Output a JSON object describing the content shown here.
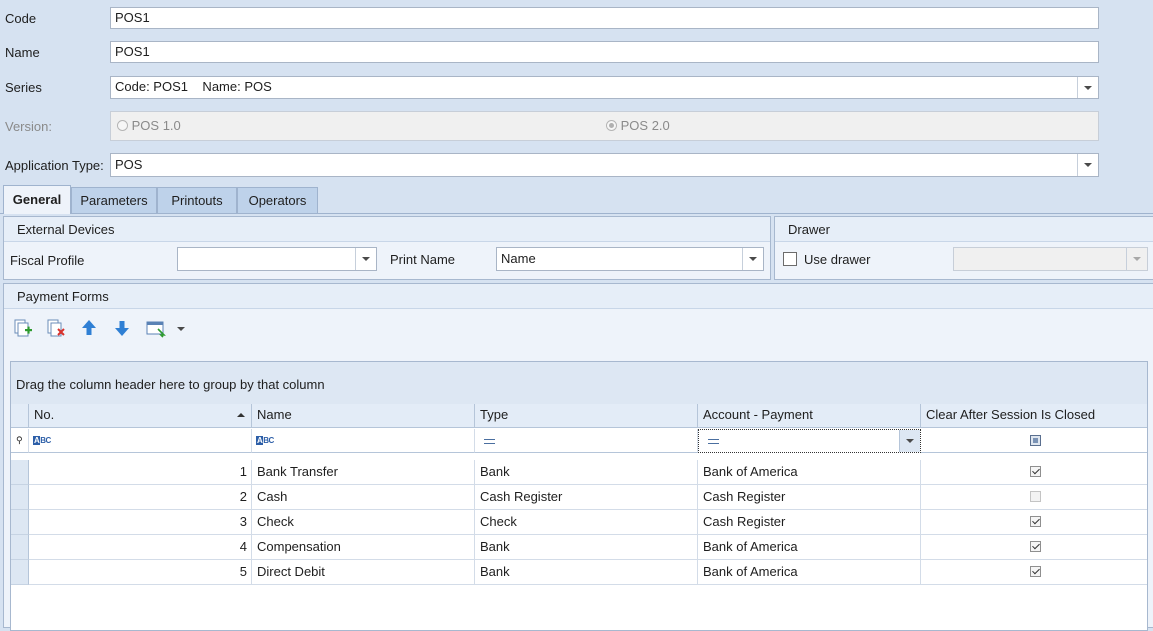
{
  "form": {
    "code_label": "Code",
    "code_value": "POS1",
    "name_label": "Name",
    "name_value": "POS1",
    "series_label": "Series",
    "series_value": "Code: POS1    Name: POS",
    "version_label": "Version:",
    "version_options": [
      "POS 1.0",
      "POS 2.0"
    ],
    "version_selected": "POS 2.0",
    "app_type_label": "Application Type:",
    "app_type_value": "POS"
  },
  "tabs": [
    "General",
    "Parameters",
    "Printouts",
    "Operators"
  ],
  "active_tab": "General",
  "external_devices": {
    "title": "External Devices",
    "fiscal_profile_label": "Fiscal Profile",
    "fiscal_profile_value": "",
    "print_name_label": "Print Name",
    "print_name_value": "Name"
  },
  "drawer": {
    "title": "Drawer",
    "use_drawer_label": "Use drawer",
    "use_drawer_checked": false,
    "drawer_value": ""
  },
  "payment_forms": {
    "title": "Payment Forms",
    "toolbar_icons": [
      "add-icon",
      "delete-icon",
      "move-up-icon",
      "move-down-icon",
      "column-chooser-icon"
    ],
    "group_panel_text": "Drag the column header here to group by that column",
    "columns": [
      "No.",
      "Name",
      "Type",
      "Account - Payment",
      "Clear After Session Is Closed"
    ],
    "rows": [
      {
        "no": "1",
        "name": "Bank Transfer",
        "type": "Bank",
        "account": "Bank of America",
        "clear": true
      },
      {
        "no": "2",
        "name": "Cash",
        "type": "Cash Register",
        "account": "Cash Register",
        "clear": false
      },
      {
        "no": "3",
        "name": "Check",
        "type": "Check",
        "account": "Cash Register",
        "clear": true
      },
      {
        "no": "4",
        "name": "Compensation",
        "type": "Bank",
        "account": "Bank of America",
        "clear": true
      },
      {
        "no": "5",
        "name": "Direct Debit",
        "type": "Bank",
        "account": "Bank of America",
        "clear": true
      }
    ]
  },
  "colors": {
    "background": "#d6e2f1",
    "tab_active": "#eef3fa",
    "tab_inactive": "#bed2ea",
    "arrow_blue": "#2f7fd4"
  }
}
